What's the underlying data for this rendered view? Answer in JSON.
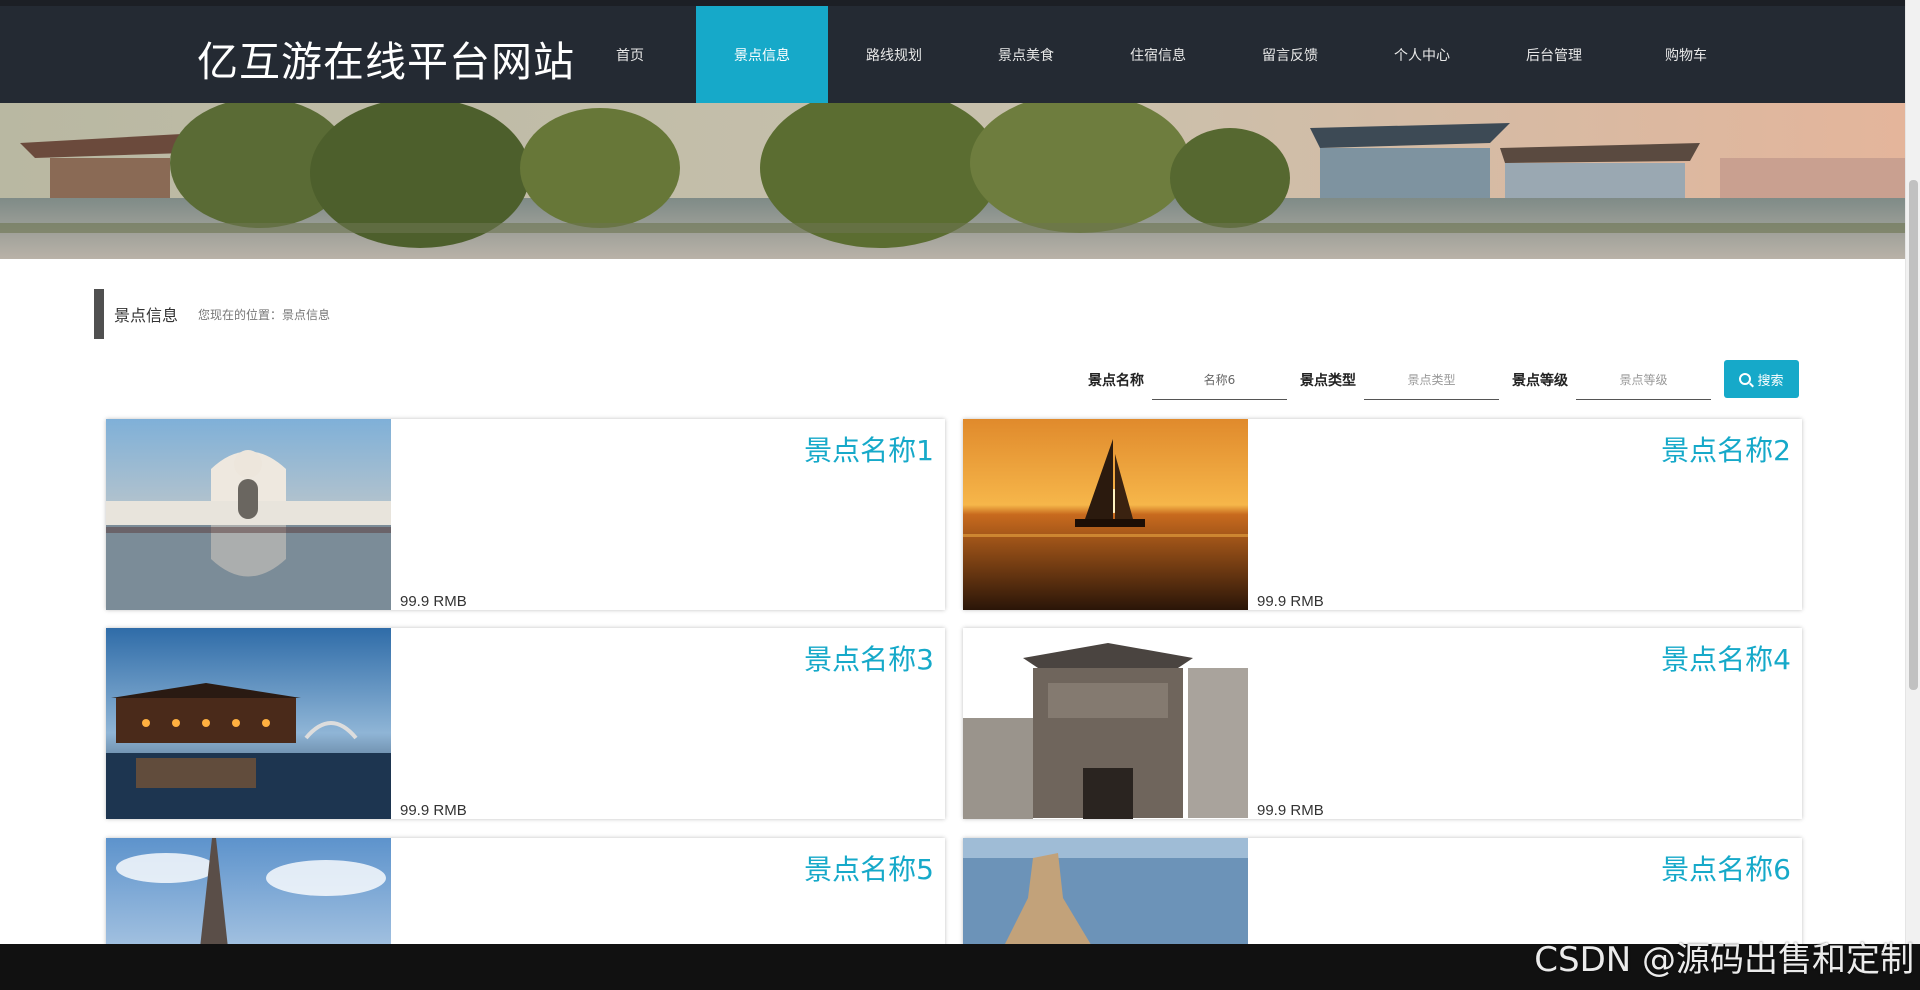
{
  "site": {
    "title": "亿互游在线平台网站"
  },
  "nav": {
    "items": [
      {
        "label": "首页"
      },
      {
        "label": "景点信息"
      },
      {
        "label": "路线规划"
      },
      {
        "label": "景点美食"
      },
      {
        "label": "住宿信息"
      },
      {
        "label": "留言反馈"
      },
      {
        "label": "个人中心"
      },
      {
        "label": "后台管理"
      },
      {
        "label": "购物车"
      }
    ],
    "active": "景点信息"
  },
  "section": {
    "title": "景点信息",
    "breadcrumb": "您现在的位置：景点信息"
  },
  "search": {
    "name_label": "景点名称",
    "name_value": "名称6",
    "type_label": "景点类型",
    "type_placeholder": "景点类型",
    "level_label": "景点等级",
    "level_placeholder": "景点等级",
    "button_label": "搜索"
  },
  "cards": [
    {
      "name": "景点名称1",
      "price": "99.9 RMB",
      "image": "palace-reflection"
    },
    {
      "name": "景点名称2",
      "price": "99.9 RMB",
      "image": "sailboat-sunset"
    },
    {
      "name": "景点名称3",
      "price": "99.9 RMB",
      "image": "water-town-night"
    },
    {
      "name": "景点名称4",
      "price": "99.9 RMB",
      "image": "ancient-gate"
    },
    {
      "name": "景点名称5",
      "price": "",
      "image": "eiffel-tower"
    },
    {
      "name": "景点名称6",
      "price": "",
      "image": "coastal-rock"
    }
  ],
  "watermark": "CSDN @源码出售和定制",
  "colors": {
    "accent": "#16a9c9",
    "nav_bg": "#242a33"
  }
}
